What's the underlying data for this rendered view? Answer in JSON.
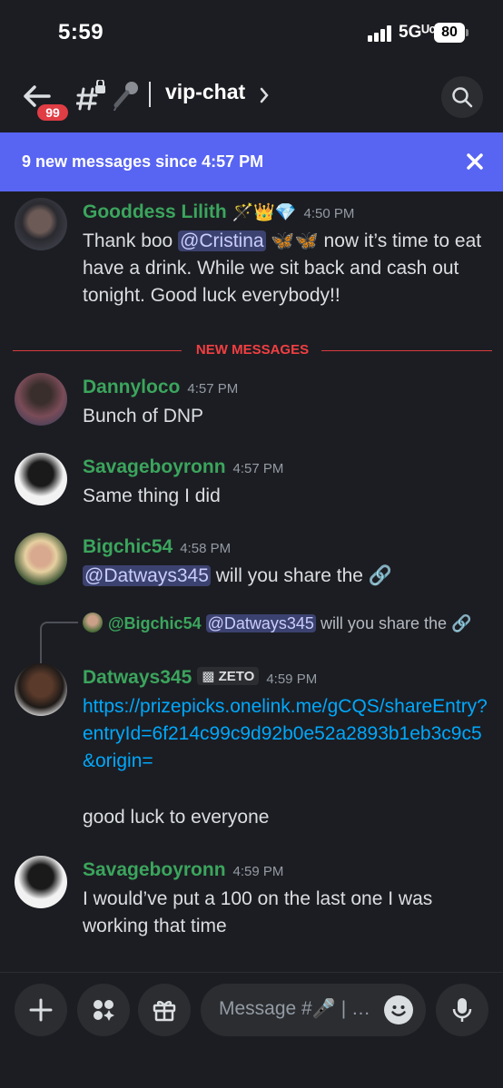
{
  "status": {
    "time": "5:59",
    "network": "5Gᵁᶜ",
    "battery": "80"
  },
  "header": {
    "unread_badge": "99",
    "channel_name": "vip-chat"
  },
  "banner": {
    "text": "9 new messages since 4:57 PM"
  },
  "messages": [
    {
      "author": "Gooddess Lilith",
      "author_emoji": "🪄👑💎",
      "time": "4:50 PM",
      "pre": "Thank boo ",
      "mention": "@Cristina",
      "post": " 🦋🦋 now it’s time to eat have a drink. While we sit back and cash out tonight. Good luck everybody!!"
    },
    {
      "author": "Dannyloco",
      "time": "4:57 PM",
      "text": "Bunch of DNP"
    },
    {
      "author": "Savageboyronn",
      "time": "4:57 PM",
      "text": "Same thing I did"
    },
    {
      "author": "Bigchic54",
      "time": "4:58 PM",
      "mention": "@Datways345",
      "post": " will you share the 🔗"
    },
    {
      "author": "Datways345",
      "role": "ZETO",
      "time": "4:59 PM",
      "link": "https://prizepicks.onelink.me/gCQS/shareEntry?entryId=6f214c99c9d92b0e52a2893b1eb3c9c5&origin=",
      "text": "good luck to everyone"
    },
    {
      "author": "Savageboyronn",
      "time": "4:59 PM",
      "text": "I would’ve put a 100 on the last one I was working that time"
    }
  ],
  "divider": {
    "label": "NEW MESSAGES"
  },
  "reply": {
    "name": "@Bigchic54",
    "mention": "@Datways345",
    "text": " will you share the 🔗"
  },
  "composer": {
    "placeholder": "Message #🎤 | …"
  },
  "colors": {
    "accent": "#5865f2",
    "username": "#3ba55d",
    "new_divider": "#f23f42",
    "link": "#00a8fc"
  }
}
